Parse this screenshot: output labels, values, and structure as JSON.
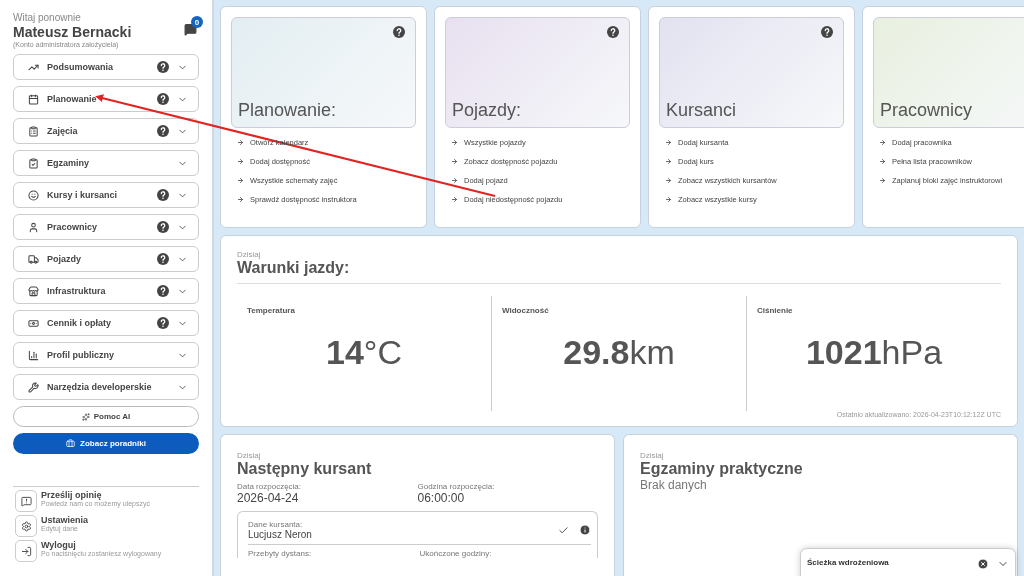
{
  "sidebar": {
    "greeting": "Witaj ponownie",
    "user_name": "Mateusz Bernacki",
    "account_type": "(Konto administratora założyciela)",
    "notification_count": "0",
    "menu": [
      {
        "label": "Podsumowania",
        "help": true,
        "expanded": false
      },
      {
        "label": "Planowanie",
        "help": true,
        "expanded": false
      },
      {
        "label": "Zajęcia",
        "help": true,
        "expanded": false
      },
      {
        "label": "Egzaminy",
        "help": false,
        "expanded": false
      },
      {
        "label": "Kursy i kursanci",
        "help": true,
        "expanded": false
      },
      {
        "label": "Pracownicy",
        "help": true,
        "expanded": false
      },
      {
        "label": "Pojazdy",
        "help": true,
        "expanded": false
      },
      {
        "label": "Infrastruktura",
        "help": true,
        "expanded": false
      },
      {
        "label": "Cennik i opłaty",
        "help": true,
        "expanded": false
      },
      {
        "label": "Profil publiczny",
        "help": false,
        "expanded": false
      },
      {
        "label": "Narzędzia developerskie",
        "help": false,
        "expanded": false
      }
    ],
    "ai_button": "Pomoc AI",
    "guides_button": "Zobacz poradniki",
    "footer": [
      {
        "title": "Prześlij opinię",
        "subtitle": "Powiedz nam co możemy ulepszyć"
      },
      {
        "title": "Ustawienia",
        "subtitle": "Edytuj dane"
      },
      {
        "title": "Wyloguj",
        "subtitle": "Po naciśnięciu zostaniesz wylogowany"
      }
    ]
  },
  "quick_cards": [
    {
      "title": "Planowanie:",
      "color": "#e3eef2",
      "help": true,
      "links": [
        "Otwórz kalendarz",
        "Dodaj dostępność",
        "Wszystkie schematy zajęć",
        "Sprawdź dostępność instruktora"
      ]
    },
    {
      "title": "Pojazdy:",
      "color": "#e8e0f0",
      "help": true,
      "links": [
        "Wszystkie pojazdy",
        "Zobacz dostępność pojazdu",
        "Dodaj pojazd",
        "Dodaj niedostępność pojazdu"
      ]
    },
    {
      "title": "Kursanci",
      "color": "#e2e2f0",
      "help": true,
      "links": [
        "Dodaj kursanta",
        "Dodaj kurs",
        "Zobacz wszystkich kursantów",
        "Zobacz wszystkie kursy"
      ]
    },
    {
      "title": "Pracownicy",
      "color": "#e8f0df",
      "help": false,
      "links": [
        "Dodaj pracownika",
        "Pełna lista pracowników",
        "Zaplanuj bloki zajęć instruktorowi"
      ]
    }
  ],
  "weather": {
    "caption": "Dzisiaj",
    "title": "Warunki jazdy:",
    "metrics": [
      {
        "label": "Temperatura",
        "value": "14",
        "unit": "°C"
      },
      {
        "label": "Widoczność",
        "value": "29.8",
        "unit": "km"
      },
      {
        "label": "Ciśnienie",
        "value": "1021",
        "unit": "hPa"
      }
    ],
    "updated": "Ostatnio aktualizowano: 2026-04-23T10:12:12Z UTC"
  },
  "next_student": {
    "caption": "Dzisiaj",
    "title": "Następny kursant",
    "fields": [
      {
        "label": "Data rozpoczęcia:",
        "value": "2026-04-24"
      },
      {
        "label": "Godzina rozpoczęcia:",
        "value": "06:00:00"
      }
    ],
    "student_label": "Dane kursanta:",
    "student_name": "Lucjusz Neron",
    "stats": [
      "Przebyty dystans:",
      "Ukończone godziny:"
    ]
  },
  "exams": {
    "caption": "Dzisiaj",
    "title": "Egzaminy praktyczne",
    "empty": "Brak danych"
  },
  "onboarding": {
    "title": "Ścieżka wdrożeniowa",
    "expanded": false
  }
}
